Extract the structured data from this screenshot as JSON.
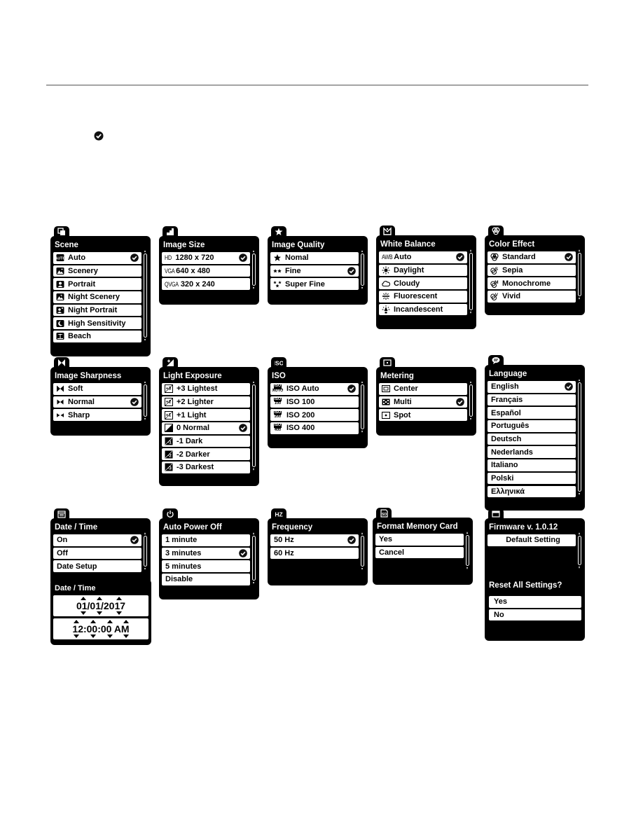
{
  "legend": {
    "check_icon": "check-circle-icon"
  },
  "menus": {
    "scene": {
      "icon": "scene-icon",
      "title": "Scene",
      "items": [
        {
          "label": "Auto",
          "icon": "auto-icon",
          "selected": true
        },
        {
          "label": "Scenery",
          "icon": "scenery-icon"
        },
        {
          "label": "Portrait",
          "icon": "portrait-icon"
        },
        {
          "label": "Night Scenery",
          "icon": "night-scenery-icon"
        },
        {
          "label": "Night Portrait",
          "icon": "night-portrait-icon"
        },
        {
          "label": "High Sensitivity",
          "icon": "high-sensitivity-icon"
        },
        {
          "label": "Beach",
          "icon": "beach-icon"
        }
      ]
    },
    "image_size": {
      "icon": "image-size-icon",
      "title": "Image Size",
      "items": [
        {
          "prefix": "HD",
          "label": "1280 x 720",
          "selected": true
        },
        {
          "prefix": "VGA",
          "label": "640 x 480"
        },
        {
          "prefix": "QVGA",
          "label": "320 x 240"
        }
      ]
    },
    "image_quality": {
      "icon": "star-icon",
      "title": "Image Quality",
      "items": [
        {
          "label": "Nomal",
          "icon": "one-star-icon"
        },
        {
          "label": "Fine",
          "icon": "two-star-icon",
          "selected": true
        },
        {
          "label": "Super Fine",
          "icon": "three-star-icon"
        }
      ]
    },
    "white_balance": {
      "icon": "white-balance-icon",
      "title": "White Balance",
      "items": [
        {
          "prefix": "AWB",
          "label": "Auto",
          "selected": true
        },
        {
          "label": "Daylight",
          "icon": "sun-icon"
        },
        {
          "label": "Cloudy",
          "icon": "cloud-icon"
        },
        {
          "label": "Fluorescent",
          "icon": "fluorescent-icon"
        },
        {
          "label": "Incandescent",
          "icon": "bulb-icon"
        }
      ]
    },
    "color_effect": {
      "icon": "color-effect-icon",
      "title": "Color Effect",
      "items": [
        {
          "label": "Standard",
          "icon": "standard-color-icon",
          "selected": true
        },
        {
          "label": "Sepia",
          "icon": "sepia-icon"
        },
        {
          "label": "Monochrome",
          "icon": "monochrome-icon"
        },
        {
          "label": "Vivid",
          "icon": "vivid-icon"
        }
      ]
    },
    "sharpness": {
      "icon": "sharpness-icon",
      "title": "Image Sharpness",
      "items": [
        {
          "label": "Soft",
          "icon": "soft-icon"
        },
        {
          "label": "Normal",
          "icon": "normal-sharp-icon",
          "selected": true
        },
        {
          "label": "Sharp",
          "icon": "sharp-icon"
        }
      ]
    },
    "exposure": {
      "icon": "exposure-icon",
      "title": "Light Exposure",
      "items": [
        {
          "label": "+3 Lightest",
          "icon": "ev-plus3-icon",
          "badge": "+3"
        },
        {
          "label": "+2 Lighter",
          "icon": "ev-plus2-icon",
          "badge": "+2"
        },
        {
          "label": "+1 Light",
          "icon": "ev-plus1-icon",
          "badge": "+1"
        },
        {
          "label": "0 Normal",
          "icon": "ev-zero-icon",
          "selected": true
        },
        {
          "label": "-1 Dark",
          "icon": "ev-minus1-icon",
          "badge": "-1"
        },
        {
          "label": "-2 Darker",
          "icon": "ev-minus2-icon",
          "badge": "-2"
        },
        {
          "label": "-3 Darkest",
          "icon": "ev-minus3-icon",
          "badge": "-3"
        }
      ]
    },
    "iso": {
      "icon": "iso-icon",
      "tab_label": "ISO",
      "title": "ISO",
      "items": [
        {
          "label": "ISO Auto",
          "sub": "AUTO",
          "selected": true
        },
        {
          "label": "ISO 100",
          "sub": "100"
        },
        {
          "label": "ISO 200",
          "sub": "200"
        },
        {
          "label": "ISO 400",
          "sub": "400"
        }
      ]
    },
    "metering": {
      "icon": "metering-icon",
      "title": "Metering",
      "items": [
        {
          "label": "Center",
          "icon": "center-metering-icon"
        },
        {
          "label": "Multi",
          "icon": "multi-metering-icon",
          "selected": true
        },
        {
          "label": "Spot",
          "icon": "spot-metering-icon"
        }
      ]
    },
    "language": {
      "icon": "speech-bubble-icon",
      "title": "Language",
      "items": [
        {
          "label": "English",
          "selected": true
        },
        {
          "label": "Français"
        },
        {
          "label": "Español"
        },
        {
          "label": "Português"
        },
        {
          "label": "Deutsch"
        },
        {
          "label": "Nederlands"
        },
        {
          "label": "Italiano"
        },
        {
          "label": "Polski"
        },
        {
          "label": "Ελληνικά"
        }
      ]
    },
    "date_time": {
      "icon": "calendar-icon",
      "title": "Date / Time",
      "items": [
        {
          "label": "On",
          "selected": true
        },
        {
          "label": "Off"
        },
        {
          "label": "Date Setup"
        }
      ]
    },
    "date_setup": {
      "title": "Date / Time",
      "date": "01/01/2017",
      "time": "12:00:00 AM"
    },
    "auto_power_off": {
      "icon": "power-icon",
      "title": "Auto Power Off",
      "items": [
        {
          "label": "1 minute"
        },
        {
          "label": "3 minutes",
          "selected": true
        },
        {
          "label": "5 minutes"
        },
        {
          "label": "Disable"
        }
      ]
    },
    "frequency": {
      "icon": "hz-icon",
      "tab_label": "HZ",
      "title": "Frequency",
      "items": [
        {
          "label": "50 Hz",
          "selected": true
        },
        {
          "label": "60 Hz"
        }
      ]
    },
    "format_card": {
      "icon": "sd-card-icon",
      "title": "Format Memory Card",
      "items": [
        {
          "label": "Yes"
        },
        {
          "label": "Cancel"
        }
      ]
    },
    "firmware": {
      "icon": "window-icon",
      "title": "Firmware v. 1.0.12",
      "items": [
        {
          "label": "Default Setting"
        }
      ]
    },
    "reset": {
      "title": "Reset All Settings?",
      "items": [
        {
          "label": "Yes"
        },
        {
          "label": "No"
        }
      ]
    }
  }
}
